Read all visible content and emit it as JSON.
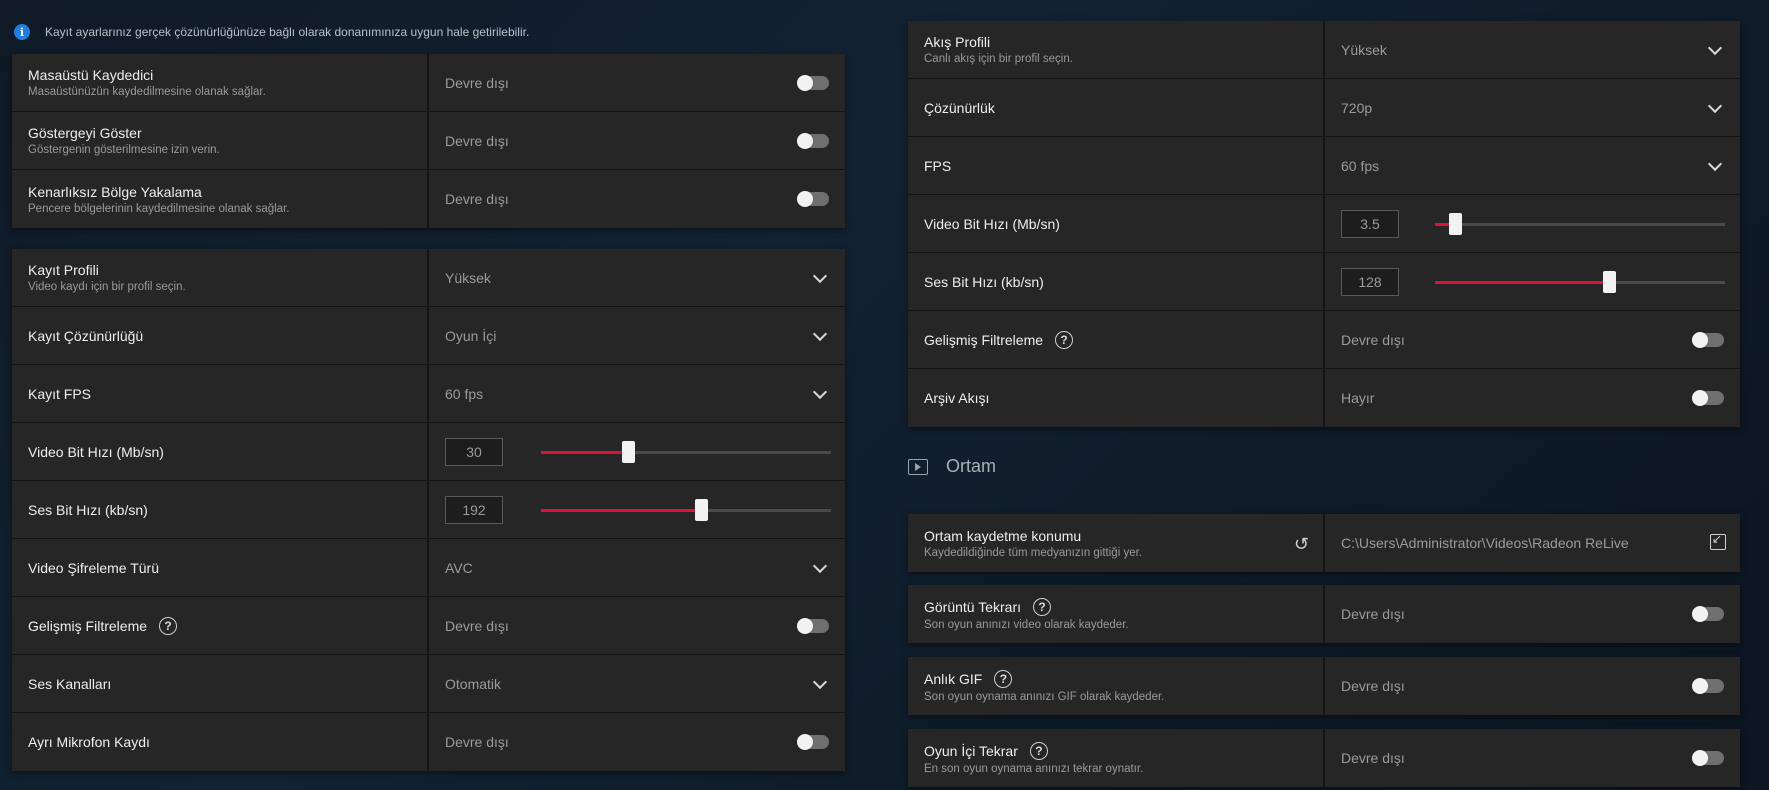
{
  "info": {
    "text": "Kayıt ayarlarınız gerçek çözünürlüğünüze bağlı olarak donanımınıza uygun hale getirilebilir."
  },
  "left": {
    "group1": [
      {
        "label": "Masaüstü Kaydedici",
        "sub": "Masaüstünüzün kaydedilmesine olanak sağlar.",
        "value": "Devre dışı"
      },
      {
        "label": "Göstergeyi Göster",
        "sub": "Göstergenin gösterilmesine izin verin.",
        "value": "Devre dışı"
      },
      {
        "label": "Kenarlıksız Bölge Yakalama",
        "sub": "Pencere bölgelerinin kaydedilmesine olanak sağlar.",
        "value": "Devre dışı"
      }
    ],
    "profile": {
      "label": "Kayıt Profili",
      "sub": "Video kaydı için bir profil seçin.",
      "value": "Yüksek"
    },
    "resolution": {
      "label": "Kayıt Çözünürlüğü",
      "value": "Oyun İçi"
    },
    "fps": {
      "label": "Kayıt FPS",
      "value": "60 fps"
    },
    "video_bitrate": {
      "label": "Video Bit Hızı (Mb/sn)",
      "value": "30",
      "fraction": 0.3
    },
    "audio_bitrate": {
      "label": "Ses Bit Hızı (kb/sn)",
      "value": "192",
      "fraction": 0.55
    },
    "codec": {
      "label": "Video Şifreleme Türü",
      "value": "AVC"
    },
    "filtering": {
      "label": "Gelişmiş Filtreleme",
      "help": "?",
      "value": "Devre dışı"
    },
    "channels": {
      "label": "Ses Kanalları",
      "value": "Otomatik"
    },
    "mic": {
      "label": "Ayrı Mikrofon Kaydı",
      "value": "Devre dışı"
    }
  },
  "right": {
    "profile": {
      "label": "Akış Profili",
      "sub": "Canlı akış için bir profil seçin.",
      "value": "Yüksek"
    },
    "resolution": {
      "label": "Çözünürlük",
      "value": "720p"
    },
    "fps": {
      "label": "FPS",
      "value": "60 fps"
    },
    "video_bitrate": {
      "label": "Video Bit Hızı (Mb/sn)",
      "value": "3.5",
      "fraction": 0.07
    },
    "audio_bitrate": {
      "label": "Ses Bit Hızı (kb/sn)",
      "value": "128",
      "fraction": 0.6
    },
    "filtering": {
      "label": "Gelişmiş Filtreleme",
      "help": "?",
      "value": "Devre dışı"
    },
    "archive": {
      "label": "Arşiv Akışı",
      "value": "Hayır"
    },
    "media_section": {
      "title": "Ortam"
    },
    "media_location": {
      "label": "Ortam kaydetme konumu",
      "sub": "Kaydedildiğinde tüm medyanızın gittiği yer.",
      "value": "C:\\Users\\Administrator\\Videos\\Radeon ReLive"
    },
    "instant_replay": {
      "label": "Görüntü Tekrarı",
      "help": "?",
      "sub": "Son oyun anınızı video olarak kaydeder.",
      "value": "Devre dışı"
    },
    "instant_gif": {
      "label": "Anlık GIF",
      "help": "?",
      "sub": "Son oyun oynama anınızı GIF olarak kaydeder.",
      "value": "Devre dışı"
    },
    "ingame_replay": {
      "label": "Oyun İçi Tekrar",
      "help": "?",
      "sub": "En son oyun oynama anınızı tekrar oynatır.",
      "value": "Devre dışı"
    }
  },
  "icons": {
    "info": "info-icon",
    "toggle": "toggle-switch",
    "dropdown": "chevron-down-icon",
    "help": "question-circle-icon",
    "media": "play-square-icon",
    "undo": "undo-icon",
    "folder": "folder-browse-icon"
  },
  "colors": {
    "accent": "#e0103a",
    "info_blue": "#1f7fe0",
    "panel": "#262626"
  }
}
